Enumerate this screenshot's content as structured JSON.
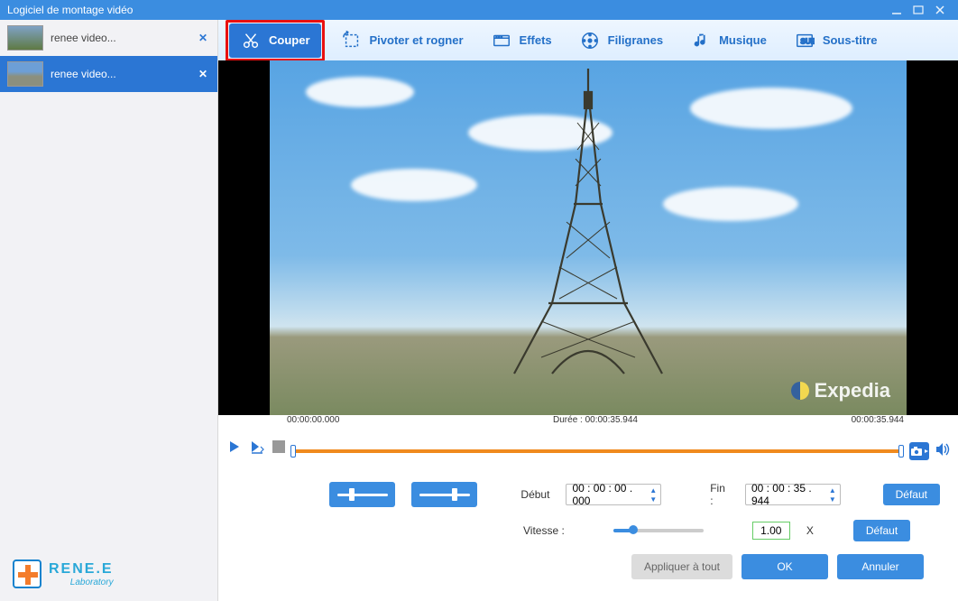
{
  "window": {
    "title": "Logiciel de montage vidéo"
  },
  "sidebar": {
    "files": [
      {
        "name": "renee video..."
      },
      {
        "name": "renee video..."
      }
    ]
  },
  "brand": {
    "line1": "RENE.E",
    "line2": "Laboratory"
  },
  "toolbar": {
    "items": [
      {
        "label": "Couper",
        "icon": "scissors-icon"
      },
      {
        "label": "Pivoter et rogner",
        "icon": "rotate-crop-icon"
      },
      {
        "label": "Effets",
        "icon": "effects-icon"
      },
      {
        "label": "Filigranes",
        "icon": "watermark-icon"
      },
      {
        "label": "Musique",
        "icon": "music-icon"
      },
      {
        "label": "Sous-titre",
        "icon": "subtitle-icon"
      }
    ]
  },
  "preview": {
    "watermark": "Expedia"
  },
  "timeline": {
    "start_label": "00:00:00.000",
    "duration_label": "Durée : 00:00:35.944",
    "end_label": "00:00:35.944"
  },
  "controls": {
    "debut_label": "Début",
    "debut_value": "00 : 00 : 00 . 000",
    "fin_label": "Fin :",
    "fin_value": "00 : 00 : 35 . 944",
    "defaut_label": "Défaut",
    "vitesse_label": "Vitesse :",
    "vitesse_value": "1.00",
    "vitesse_unit": "X"
  },
  "footer": {
    "apply_all": "Appliquer à tout",
    "ok": "OK",
    "cancel": "Annuler"
  }
}
